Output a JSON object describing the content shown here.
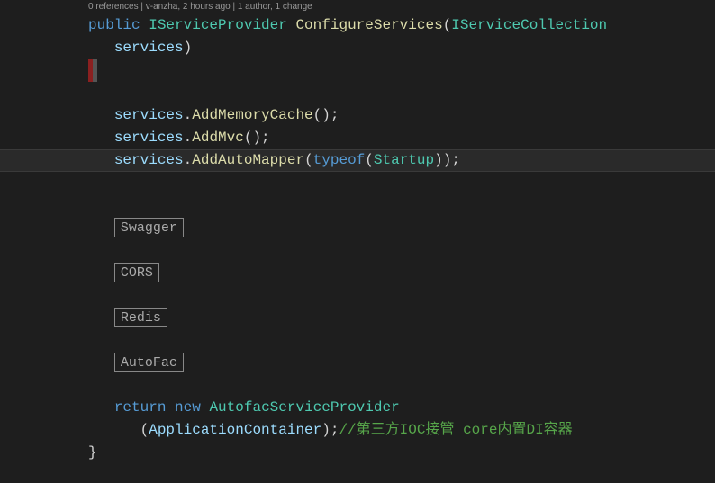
{
  "codelens": "0 references | v-anzha, 2 hours ago | 1 author, 1 change",
  "signature": {
    "modifier": "public",
    "return_type": "IServiceProvider",
    "method_name": "ConfigureServices",
    "param_type": "IServiceCollection",
    "param_name": "services"
  },
  "brace_open": "{",
  "body": {
    "l1_obj": "services",
    "l1_method": "AddMemoryCache",
    "l1_rest": "();",
    "l2_obj": "services",
    "l2_method": "AddMvc",
    "l2_rest": "();",
    "l3_obj": "services",
    "l3_method": "AddAutoMapper",
    "l3_p1": "(",
    "l3_typeof": "typeof",
    "l3_p2": "(",
    "l3_type": "Startup",
    "l3_rest": "));"
  },
  "regions": {
    "r1": "Swagger",
    "r2": "CORS",
    "r3": "Redis",
    "r4": "AutoFac"
  },
  "ret": {
    "kw_return": "return",
    "kw_new": "new",
    "type": "AutofacServiceProvider",
    "paren_open": "(",
    "arg": "ApplicationContainer",
    "paren_close_semi": ");",
    "comment": "//第三方IOC接管 core内置DI容器"
  },
  "brace_close": "}"
}
